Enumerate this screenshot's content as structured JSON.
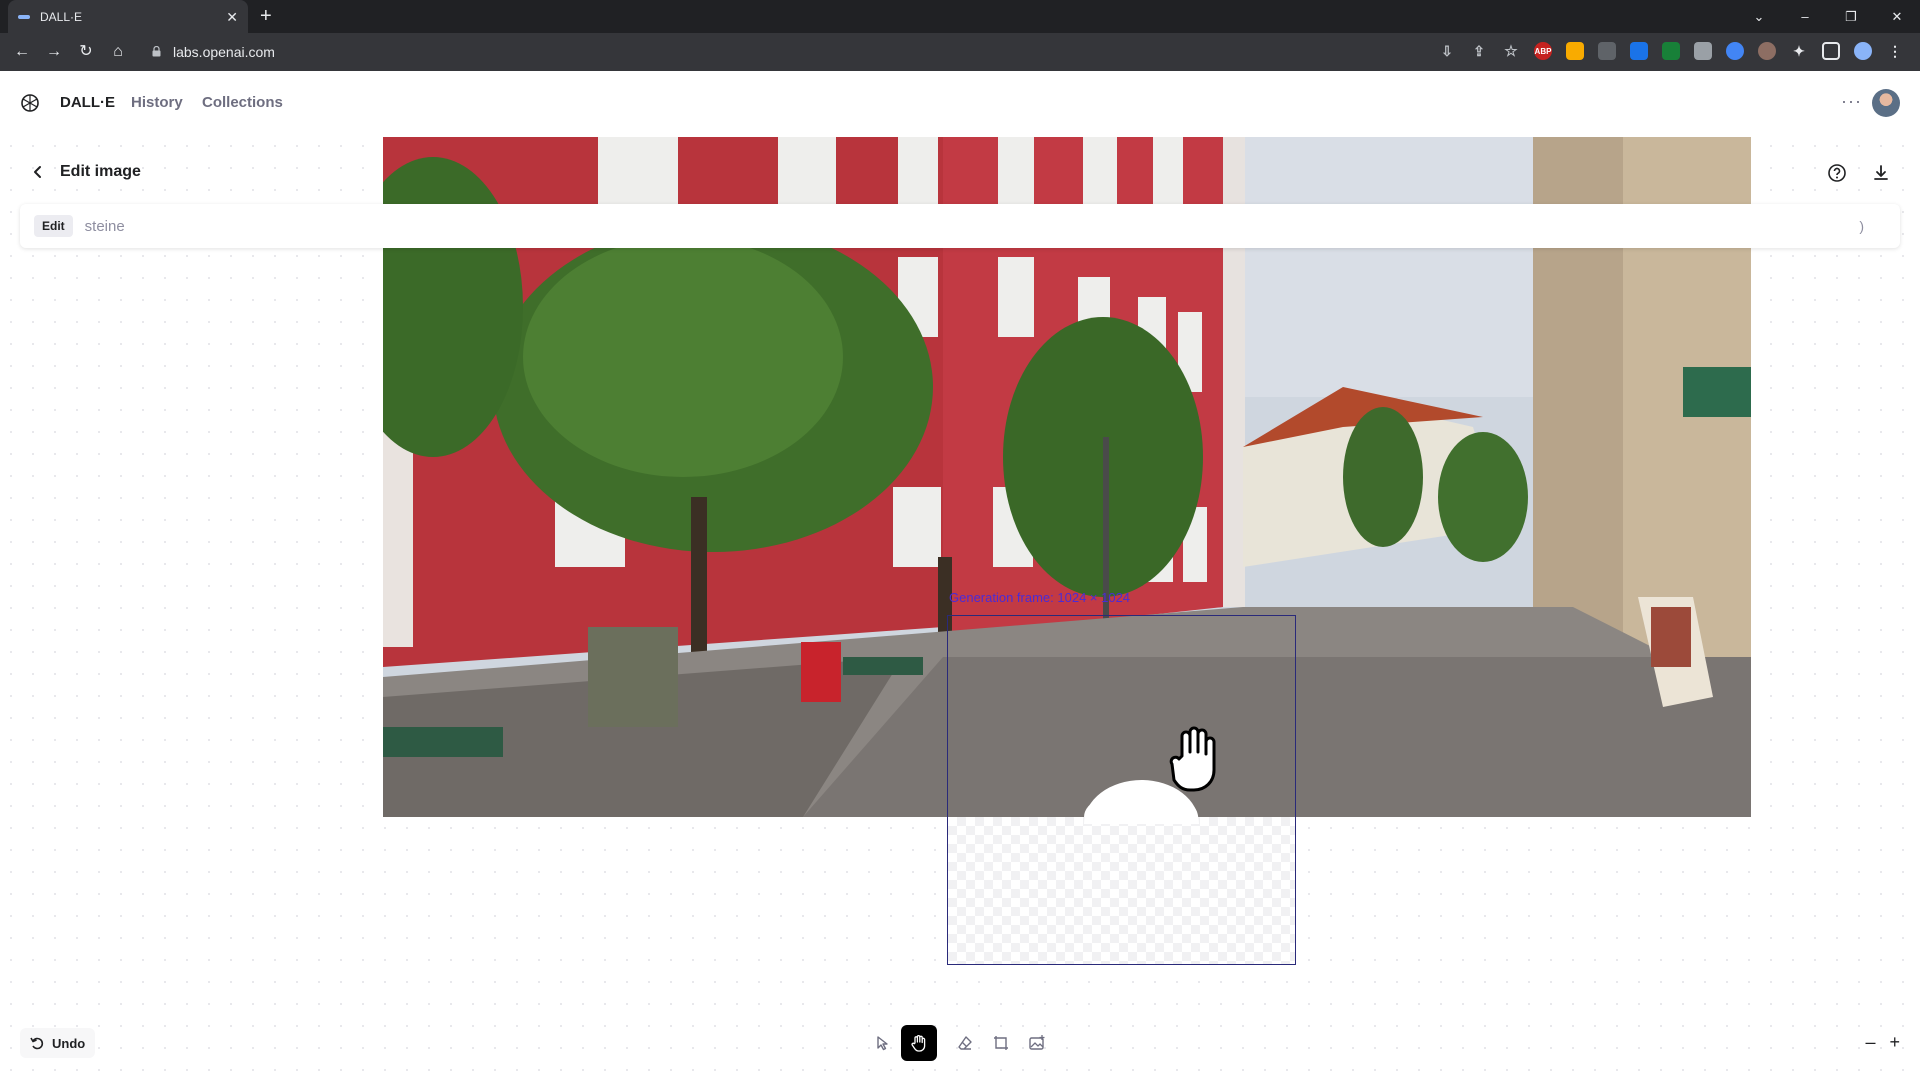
{
  "browser": {
    "tab_title": "DALL·E",
    "url": "labs.openai.com",
    "icons": [
      "back-icon",
      "forward-icon",
      "reload-icon",
      "home-icon",
      "lock-icon",
      "install-icon",
      "share-icon",
      "bookmark-star-icon",
      "extensions-icon",
      "sidebar-icon",
      "profile-avatar",
      "menu-icon"
    ]
  },
  "app": {
    "brand": "DALL·E",
    "nav": {
      "history": "History",
      "collections": "Collections"
    },
    "more": "···"
  },
  "editor": {
    "title": "Edit image",
    "mode_chip": "Edit",
    "prompt_value": "steine",
    "prompt_end": ")",
    "generation_frame_label": "Generation frame: 1024 × 1024",
    "undo_label": "Undo",
    "zoom_out": "–",
    "zoom_in": "+",
    "tools": [
      "select-icon",
      "hand-icon",
      "eraser-icon",
      "add-frame-icon",
      "upload-image-icon"
    ],
    "active_tool": "hand-icon"
  },
  "colors": {
    "accent": "#4b2bd6",
    "frame_border": "#2a2a7a",
    "tool_active_bg": "#000000"
  }
}
